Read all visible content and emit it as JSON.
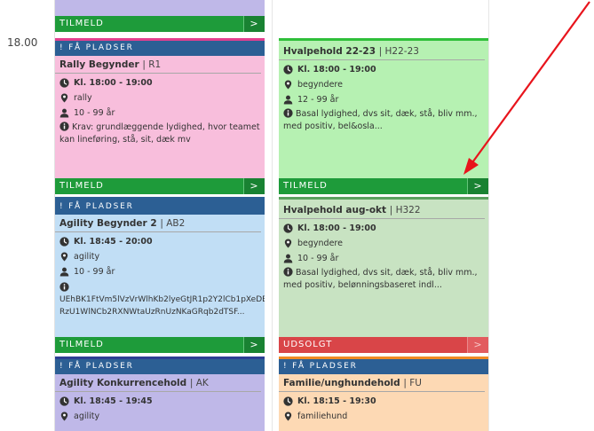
{
  "schedule": {
    "time_slot": "18.00",
    "fa_pladser_label": "! FÅ PLADSER",
    "signup_label": "TILMELD",
    "soldout_label": "UDSOLGT",
    "arrow_glyph": ">"
  },
  "cards": {
    "rally": {
      "title": "Rally Begynder",
      "code": "| R1",
      "time": "Kl. 18:00 - 19:00",
      "location": "rally",
      "age": "10 - 99 år",
      "info": "Krav: grundlæggende lydighed, hvor teamet kan lineføring, stå, sit, dæk mv"
    },
    "hvalpehold1": {
      "title": "Hvalpehold 22-23",
      "code": "| H22-23",
      "time": "Kl. 18:00 - 19:00",
      "location": "begyndere",
      "age": "12 - 99 år",
      "info": "Basal lydighed, dvs sit, dæk, stå, bliv mm., med positiv, bel&osla..."
    },
    "agility": {
      "title": "Agility Begynder 2",
      "code": "| AB2",
      "time": "Kl. 18:45 - 20:00",
      "location": "agility",
      "age": "10 - 99 år",
      "info_line1": "UEhBK1FtVm5lVzVrWlhKb2lyeGtJR1p2Y2lCb1pXeDBJ",
      "info_line2": "RzU1WlNCb2RXNWtaUzRnUzNKaGRqb2dTSF..."
    },
    "hvalpehold2": {
      "title": "Hvalpehold aug-okt",
      "code": "| H322",
      "time": "Kl. 18:00 - 19:00",
      "location": "begyndere",
      "age": "10 - 99 år",
      "info": "Basal lydighed, dvs sit, dæk, stå, bliv mm., med positiv, belønningsbaseret indl..."
    },
    "konkurrence": {
      "title": "Agility Konkurrencehold",
      "code": "| AK",
      "time": "Kl. 18:45 - 19:45",
      "location": "agility"
    },
    "familie": {
      "title": "Familie/unghundehold",
      "code": "| FU",
      "time": "Kl. 18:15 - 19:30",
      "location": "familiehund"
    }
  },
  "colors": {
    "fa_bar": "#2c5f94",
    "signup": "#1e9b3a",
    "soldout": "#d94548",
    "annotation_arrow": "#e8141c"
  }
}
